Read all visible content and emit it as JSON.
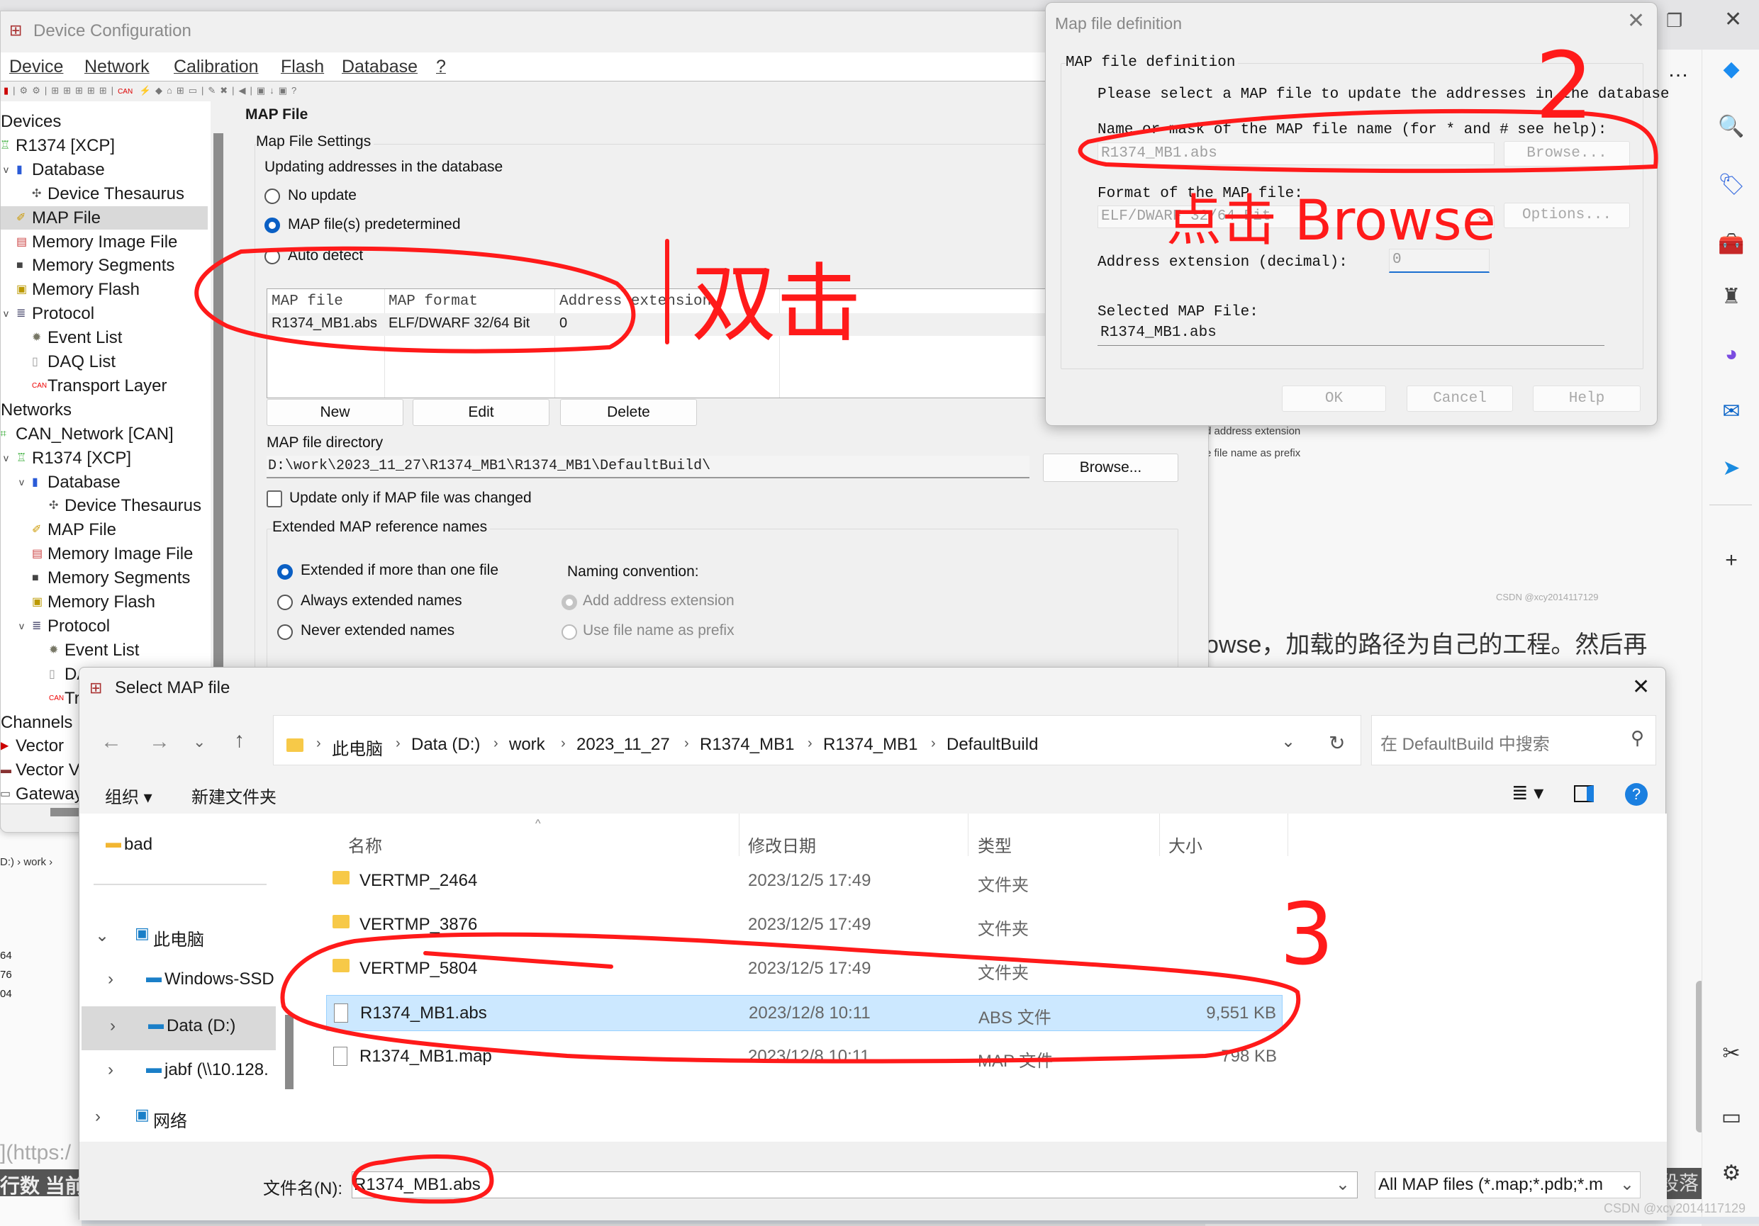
{
  "device_config": {
    "title": "Device Configuration",
    "menu": [
      "Device",
      "Network",
      "Calibration",
      "Flash",
      "Database",
      "?"
    ],
    "tree": [
      {
        "label": "Devices",
        "level": 0,
        "icon": "",
        "chev": ""
      },
      {
        "label": "R1374 [XCP]",
        "level": 1,
        "icon": "device-icon",
        "chev": ""
      },
      {
        "label": "Database",
        "level": 2,
        "icon": "database-icon",
        "chev": "v"
      },
      {
        "label": "Device Thesaurus",
        "level": 3,
        "icon": "thesaurus-icon",
        "chev": ""
      },
      {
        "label": "MAP File",
        "level": 2,
        "icon": "map-file-icon",
        "chev": "",
        "selected": true
      },
      {
        "label": "Memory Image File",
        "level": 2,
        "icon": "memory-image-icon",
        "chev": ""
      },
      {
        "label": "Memory Segments",
        "level": 2,
        "icon": "memory-segments-icon",
        "chev": ""
      },
      {
        "label": "Memory Flash",
        "level": 2,
        "icon": "memory-flash-icon",
        "chev": ""
      },
      {
        "label": "Protocol",
        "level": 2,
        "icon": "protocol-icon",
        "chev": "v"
      },
      {
        "label": "Event List",
        "level": 3,
        "icon": "event-list-icon",
        "chev": ""
      },
      {
        "label": "DAQ List",
        "level": 3,
        "icon": "daq-list-icon",
        "chev": ""
      },
      {
        "label": "Transport Layer",
        "level": 3,
        "icon": "can-icon",
        "chev": ""
      },
      {
        "label": "Networks",
        "level": 0,
        "icon": "",
        "chev": ""
      },
      {
        "label": "CAN_Network [CAN]",
        "level": 1,
        "icon": "network-icon",
        "chev": ""
      },
      {
        "label": "R1374 [XCP]",
        "level": 2,
        "icon": "device-icon",
        "chev": "v"
      },
      {
        "label": "Database",
        "level": 3,
        "icon": "database-icon",
        "chev": "v"
      },
      {
        "label": "Device Thesaurus",
        "level": 4,
        "icon": "thesaurus-icon",
        "chev": ""
      },
      {
        "label": "MAP File",
        "level": 3,
        "icon": "map-file-icon",
        "chev": ""
      },
      {
        "label": "Memory Image File",
        "level": 3,
        "icon": "memory-image-icon",
        "chev": ""
      },
      {
        "label": "Memory Segments",
        "level": 3,
        "icon": "memory-segments-icon",
        "chev": ""
      },
      {
        "label": "Memory Flash",
        "level": 3,
        "icon": "memory-flash-icon",
        "chev": ""
      },
      {
        "label": "Protocol",
        "level": 3,
        "icon": "protocol-icon",
        "chev": "v"
      },
      {
        "label": "Event List",
        "level": 4,
        "icon": "event-list-icon",
        "chev": ""
      },
      {
        "label": "DAQ List",
        "level": 4,
        "icon": "daq-list-icon",
        "chev": ""
      },
      {
        "label": "Transport Layer",
        "level": 4,
        "icon": "can-icon",
        "chev": ""
      },
      {
        "label": "Channels",
        "level": 0,
        "icon": "",
        "chev": ""
      },
      {
        "label": "Vector",
        "level": 1,
        "icon": "vector-icon",
        "chev": ""
      },
      {
        "label": "Vector VN",
        "level": 1,
        "icon": "vector-device-icon",
        "chev": ""
      },
      {
        "label": "Gateway",
        "level": 1,
        "icon": "gateway-icon",
        "chev": ""
      }
    ],
    "panel": {
      "heading": "MAP File",
      "settings_group": "Map File Settings",
      "updating_label": "Updating addresses in the database",
      "radios": [
        {
          "label": "No update",
          "checked": false
        },
        {
          "label": "MAP file(s) predetermined",
          "checked": true
        },
        {
          "label": "Auto detect",
          "checked": false
        }
      ],
      "table": {
        "columns": [
          "MAP file",
          "MAP format",
          "Address extension"
        ],
        "rows": [
          [
            "R1374_MB1.abs",
            "ELF/DWARF 32/64 Bit",
            "0"
          ]
        ]
      },
      "buttons": {
        "new": "New",
        "edit": "Edit",
        "delete": "Delete"
      },
      "dir_label": "MAP file directory",
      "dir_value": "D:\\work\\2023_11_27\\R1374_MB1\\R1374_MB1\\DefaultBuild\\",
      "browse": "Browse...",
      "update_only_label": "Update only if MAP file was changed",
      "update_only_checked": false,
      "ext_group": "Extended MAP reference names",
      "ext_radios": [
        {
          "label": "Extended if more than one file",
          "checked": true
        },
        {
          "label": "Always extended names",
          "checked": false
        },
        {
          "label": "Never extended names",
          "checked": false
        }
      ],
      "naming_label": "Naming convention:",
      "naming_radios": [
        {
          "label": "Add address extension",
          "checked": true,
          "disabled": true
        },
        {
          "label": "Use file name as prefix",
          "checked": false,
          "disabled": true
        }
      ]
    }
  },
  "map_dialog": {
    "title": "Map file definition",
    "group": "MAP file definition",
    "instruction": "Please select a MAP file to update the addresses in the database",
    "name_label": "Name or mask of the MAP file name (for * and # see help):",
    "name_value": "R1374_MB1.abs",
    "browse": "Browse...",
    "format_label": "Format of the MAP file:",
    "format_value": "ELF/DWARF 32/64 Bit",
    "options": "Options...",
    "addr_label": "Address extension (decimal):",
    "addr_value": "0",
    "selected_label": "Selected MAP File:",
    "selected_value": "R1374_MB1.abs",
    "ok": "OK",
    "cancel": "Cancel",
    "help": "Help"
  },
  "file_dialog": {
    "title": "Select MAP file",
    "breadcrumb": [
      "此电脑",
      "Data (D:)",
      "work",
      "2023_11_27",
      "R1374_MB1",
      "R1374_MB1",
      "DefaultBuild"
    ],
    "search_placeholder": "在 DefaultBuild 中搜索",
    "organize": "组织 ▾",
    "new_folder": "新建文件夹",
    "nav": [
      {
        "label": "bad",
        "icon": "folder-icon"
      },
      {
        "label": "此电脑",
        "icon": "computer-icon",
        "chev": "v"
      },
      {
        "label": "Windows-SSD",
        "icon": "drive-icon",
        "chev": ">"
      },
      {
        "label": "Data (D:)",
        "icon": "drive-icon",
        "chev": ">",
        "selected": true
      },
      {
        "label": "jabf (\\\\10.128.",
        "icon": "network-drive-icon",
        "chev": ">"
      },
      {
        "label": "网络",
        "icon": "network-icon",
        "chev": ">"
      }
    ],
    "columns": [
      "名称",
      "修改日期",
      "类型",
      "大小"
    ],
    "files": [
      {
        "name": "VERTMP_2464",
        "date": "2023/12/5 17:49",
        "type": "文件夹",
        "size": "",
        "kind": "folder"
      },
      {
        "name": "VERTMP_3876",
        "date": "2023/12/5 17:49",
        "type": "文件夹",
        "size": "",
        "kind": "folder"
      },
      {
        "name": "VERTMP_5804",
        "date": "2023/12/5 17:49",
        "type": "文件夹",
        "size": "",
        "kind": "folder"
      },
      {
        "name": "R1374_MB1.abs",
        "date": "2023/12/8 10:11",
        "type": "ABS 文件",
        "size": "9,551 KB",
        "kind": "file",
        "selected": true
      },
      {
        "name": "R1374_MB1.map",
        "date": "2023/12/8 10:11",
        "type": "MAP 文件",
        "size": "798 KB",
        "kind": "file"
      }
    ],
    "filename_label": "文件名(N):",
    "filename_value": "R1374_MB1.abs",
    "filter_value": "All MAP files (*.map;*.pdb;*.m"
  },
  "background": {
    "article_fragments": [
      "d address extension",
      "e file name as prefix",
      "CSDN @xcy2014117129"
    ],
    "article_text": "owse，加载的路径为自己的工程。然后再",
    "explorer_crumb": "D:)  ›  work  ›",
    "explorer_nums": [
      "64",
      "76",
      "04"
    ],
    "link_text": "](https:/",
    "statusbar_text": "行数  当前",
    "paragraph_btn": "段落",
    "watermark": "CSDN @xcy2014117129"
  },
  "annotations": {
    "double_click": "双击",
    "click_browse": "点击 Browse",
    "step2": "2",
    "step3": "3",
    "color": "#ff1a1a"
  }
}
